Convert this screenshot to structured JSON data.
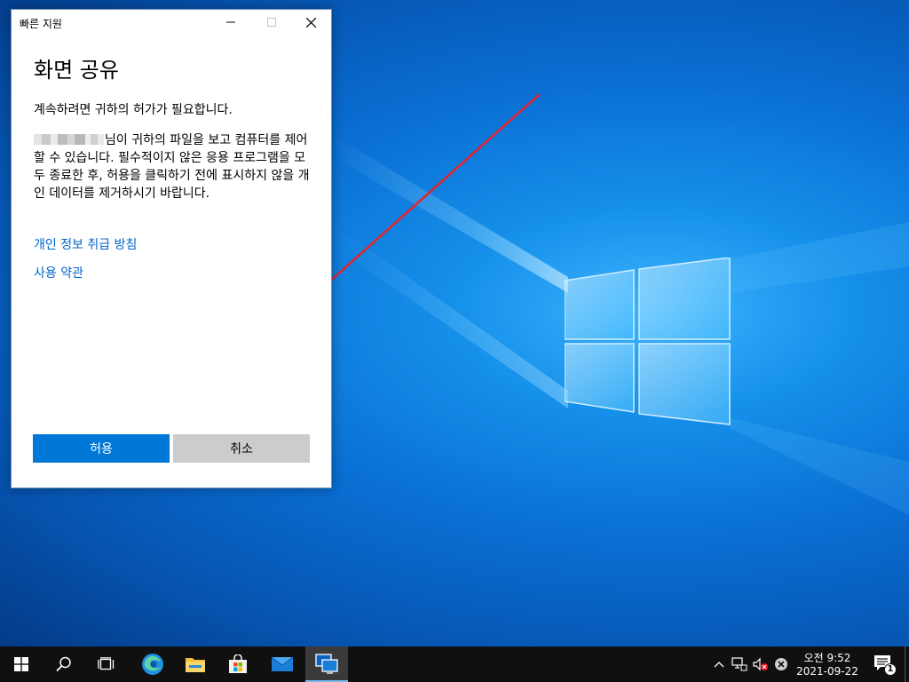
{
  "dialog": {
    "window_title": "빠른 지원",
    "heading": "화면 공유",
    "permission_text": "계속하려면 귀하의 허가가 필요합니다.",
    "description": "님이 귀하의 파일을 보고 컴퓨터를 제어할 수 있습니다. 필수적이지 않은 응용 프로그램을 모두 종료한 후, 허용을 클릭하기 전에 표시하지 않을 개인 데이터를 제거하시기 바랍니다.",
    "links": {
      "privacy": "개인 정보 취급 방침",
      "terms": "사용 약관"
    },
    "buttons": {
      "allow": "허용",
      "cancel": "취소"
    },
    "accent_color": "#0078d7"
  },
  "taskbar": {
    "items": [
      "windows-start-icon",
      "search-icon",
      "task-view-icon",
      "edge-icon",
      "file-explorer-icon",
      "store-icon",
      "mail-icon",
      "quick-assist-icon"
    ],
    "tray": {
      "time": "오전 9:52",
      "date": "2021-09-22",
      "notification_count": "1"
    }
  }
}
